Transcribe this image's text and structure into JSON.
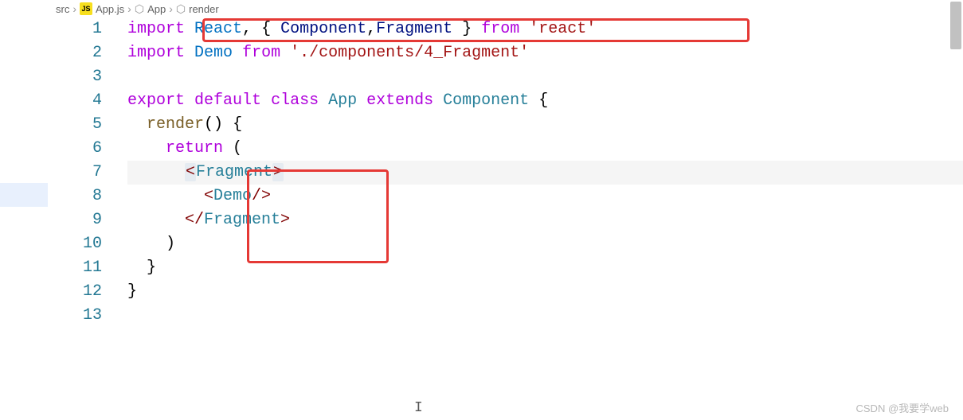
{
  "breadcrumb": {
    "root": "src",
    "file": "App.js",
    "symbol1": "App",
    "symbol2": "render"
  },
  "lines": {
    "l1": {
      "n": "1"
    },
    "l2": {
      "n": "2"
    },
    "l3": {
      "n": "3"
    },
    "l4": {
      "n": "4"
    },
    "l5": {
      "n": "5"
    },
    "l6": {
      "n": "6"
    },
    "l7": {
      "n": "7"
    },
    "l8": {
      "n": "8"
    },
    "l9": {
      "n": "9"
    },
    "l10": {
      "n": "10"
    },
    "l11": {
      "n": "11"
    },
    "l12": {
      "n": "12"
    },
    "l13": {
      "n": "13"
    }
  },
  "code": {
    "import": "import",
    "react": "React",
    "component": "Component",
    "fragment": "Fragment",
    "from": "from",
    "reactPkg": "'react'",
    "demo": "Demo",
    "demoPath": "'./components/4_Fragment'",
    "export": "export",
    "default": "default",
    "class": "class",
    "app": "App",
    "extends": "extends",
    "render": "render",
    "return": "return",
    "lbrace": "{",
    "rbrace": "}",
    "lparen": "(",
    "rparen": ")",
    "comma": ",",
    "space": " ",
    "lt": "<",
    "gt": ">",
    "ltSlash": "</",
    "slashGt": "/>"
  },
  "watermark": "CSDN @我要学web",
  "jsLabel": "JS"
}
